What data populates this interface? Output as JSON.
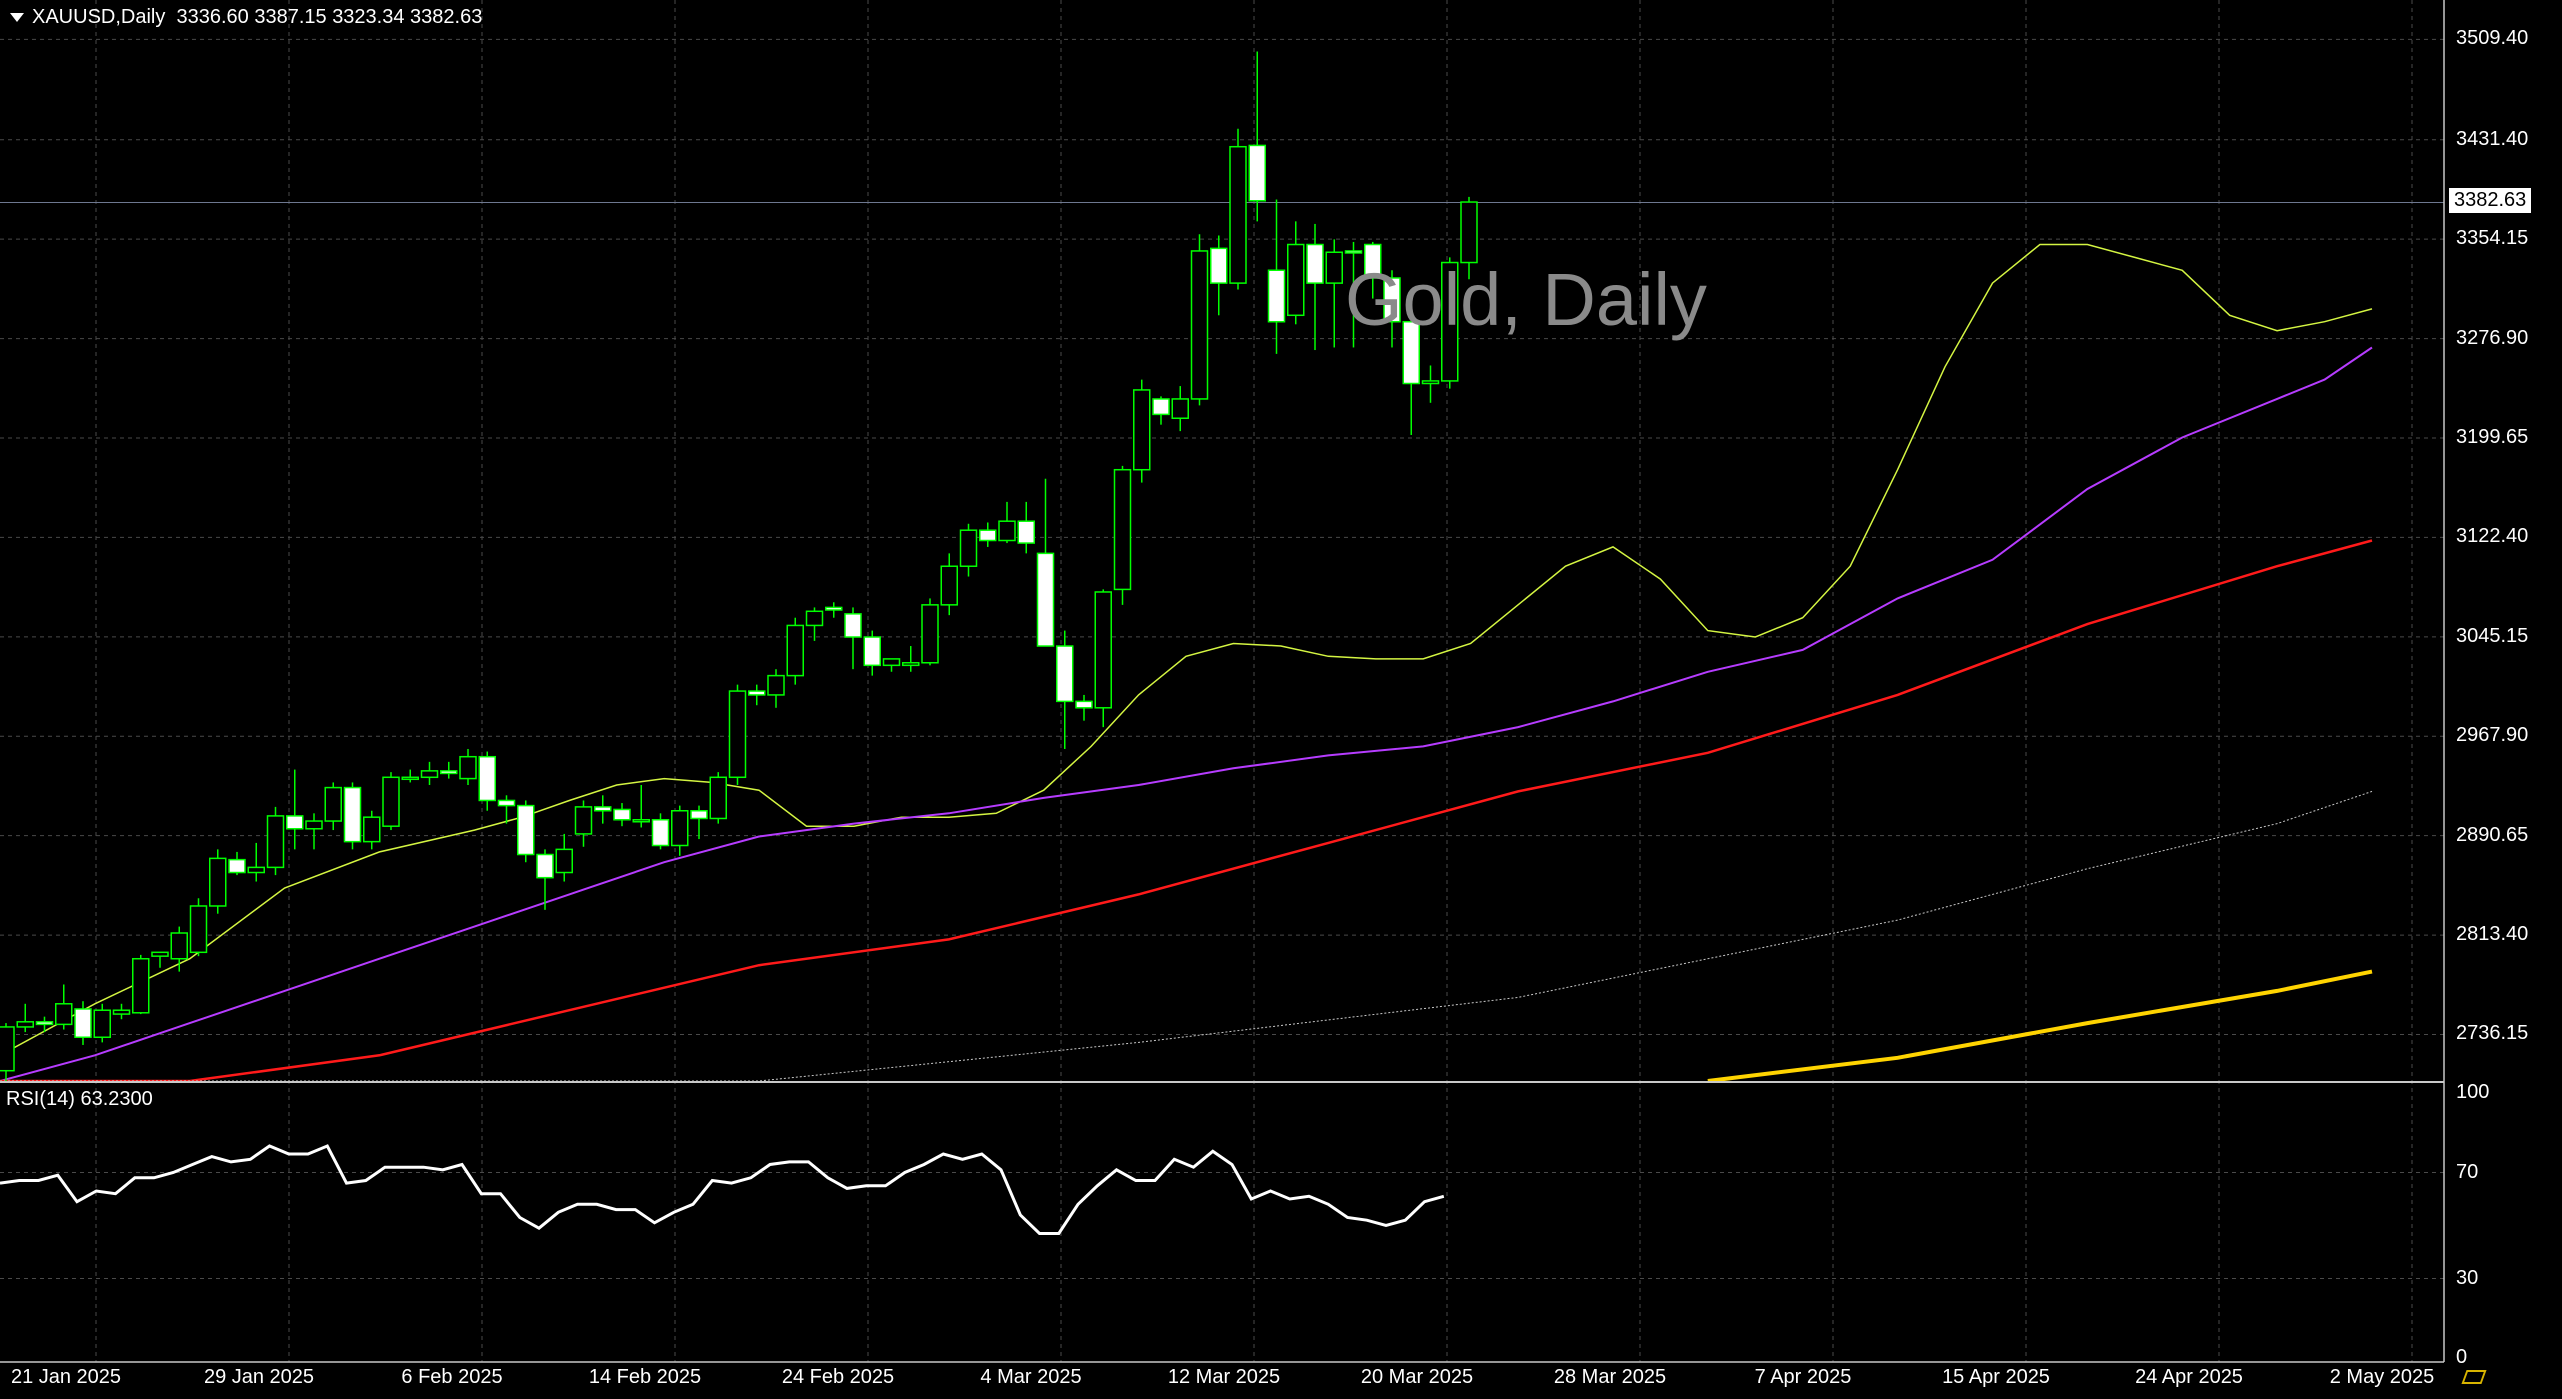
{
  "header": {
    "symbol": "XAUUSD,Daily",
    "ohlc": "3336.60 3387.15 3323.34 3382.63"
  },
  "watermark": "Gold, Daily",
  "last_price_label": "3382.63",
  "rsi_header": "RSI(14) 63.2300",
  "colors": {
    "background": "#000000",
    "candle_up": "#000000",
    "candle_down": "#ffffff",
    "wick": "#00ff00",
    "ma_fast": "#d4f542",
    "ma_mid": "#b63cff",
    "ma_slow": "#ff1a1a",
    "ma_200": "#c8c8c8",
    "ma_yellow": "#ffd400",
    "grid": "#4a4a4a",
    "rsi": "#ffffff"
  },
  "chart_data": {
    "type": "candlestick",
    "symbol": "XAUUSD",
    "timeframe": "Daily",
    "ylim": [
      2700,
      3540
    ],
    "y_ticks": [
      "3509.40",
      "3431.40",
      "3354.15",
      "3276.90",
      "3199.65",
      "3122.40",
      "3045.15",
      "2967.90",
      "2890.65",
      "2813.40",
      "2736.15"
    ],
    "x_ticks": [
      "21 Jan 2025",
      "29 Jan 2025",
      "6 Feb 2025",
      "14 Feb 2025",
      "24 Feb 2025",
      "4 Mar 2025",
      "12 Mar 2025",
      "20 Mar 2025",
      "28 Mar 2025",
      "7 Apr 2025",
      "15 Apr 2025",
      "24 Apr 2025",
      "2 May 2025"
    ],
    "last_price": 3382.63,
    "candles": [
      {
        "o": 2708,
        "h": 2745,
        "l": 2700,
        "c": 2742
      },
      {
        "o": 2742,
        "h": 2760,
        "l": 2738,
        "c": 2746
      },
      {
        "o": 2746,
        "h": 2750,
        "l": 2738,
        "c": 2744
      },
      {
        "o": 2744,
        "h": 2775,
        "l": 2740,
        "c": 2760
      },
      {
        "o": 2756,
        "h": 2762,
        "l": 2728,
        "c": 2734
      },
      {
        "o": 2734,
        "h": 2760,
        "l": 2730,
        "c": 2755
      },
      {
        "o": 2752,
        "h": 2760,
        "l": 2748,
        "c": 2755
      },
      {
        "o": 2753,
        "h": 2798,
        "l": 2752,
        "c": 2795
      },
      {
        "o": 2797,
        "h": 2800,
        "l": 2788,
        "c": 2800
      },
      {
        "o": 2795,
        "h": 2820,
        "l": 2785,
        "c": 2815
      },
      {
        "o": 2800,
        "h": 2842,
        "l": 2797,
        "c": 2836
      },
      {
        "o": 2836,
        "h": 2880,
        "l": 2830,
        "c": 2873
      },
      {
        "o": 2872,
        "h": 2878,
        "l": 2860,
        "c": 2862
      },
      {
        "o": 2862,
        "h": 2885,
        "l": 2855,
        "c": 2866
      },
      {
        "o": 2866,
        "h": 2913,
        "l": 2860,
        "c": 2906
      },
      {
        "o": 2906,
        "h": 2942,
        "l": 2880,
        "c": 2896
      },
      {
        "o": 2896,
        "h": 2908,
        "l": 2880,
        "c": 2902
      },
      {
        "o": 2902,
        "h": 2932,
        "l": 2895,
        "c": 2928
      },
      {
        "o": 2928,
        "h": 2932,
        "l": 2880,
        "c": 2886
      },
      {
        "o": 2886,
        "h": 2910,
        "l": 2880,
        "c": 2905
      },
      {
        "o": 2898,
        "h": 2940,
        "l": 2895,
        "c": 2936
      },
      {
        "o": 2936,
        "h": 2942,
        "l": 2932,
        "c": 2936
      },
      {
        "o": 2936,
        "h": 2948,
        "l": 2930,
        "c": 2941
      },
      {
        "o": 2941,
        "h": 2948,
        "l": 2935,
        "c": 2939
      },
      {
        "o": 2935,
        "h": 2958,
        "l": 2930,
        "c": 2952
      },
      {
        "o": 2952,
        "h": 2956,
        "l": 2910,
        "c": 2918
      },
      {
        "o": 2918,
        "h": 2922,
        "l": 2900,
        "c": 2914
      },
      {
        "o": 2914,
        "h": 2918,
        "l": 2870,
        "c": 2876
      },
      {
        "o": 2876,
        "h": 2880,
        "l": 2833,
        "c": 2858
      },
      {
        "o": 2862,
        "h": 2892,
        "l": 2855,
        "c": 2880
      },
      {
        "o": 2892,
        "h": 2918,
        "l": 2882,
        "c": 2913
      },
      {
        "o": 2913,
        "h": 2922,
        "l": 2900,
        "c": 2910
      },
      {
        "o": 2911,
        "h": 2916,
        "l": 2898,
        "c": 2903
      },
      {
        "o": 2903,
        "h": 2930,
        "l": 2897,
        "c": 2903
      },
      {
        "o": 2903,
        "h": 2908,
        "l": 2880,
        "c": 2883
      },
      {
        "o": 2883,
        "h": 2914,
        "l": 2875,
        "c": 2910
      },
      {
        "o": 2910,
        "h": 2914,
        "l": 2888,
        "c": 2904
      },
      {
        "o": 2904,
        "h": 2940,
        "l": 2900,
        "c": 2936
      },
      {
        "o": 2936,
        "h": 3008,
        "l": 2930,
        "c": 3003
      },
      {
        "o": 3003,
        "h": 3008,
        "l": 2992,
        "c": 3000
      },
      {
        "o": 3000,
        "h": 3020,
        "l": 2990,
        "c": 3015
      },
      {
        "o": 3015,
        "h": 3060,
        "l": 3008,
        "c": 3054
      },
      {
        "o": 3054,
        "h": 3068,
        "l": 3042,
        "c": 3065
      },
      {
        "o": 3068,
        "h": 3072,
        "l": 3060,
        "c": 3066
      },
      {
        "o": 3063,
        "h": 3068,
        "l": 3020,
        "c": 3045
      },
      {
        "o": 3045,
        "h": 3050,
        "l": 3015,
        "c": 3023
      },
      {
        "o": 3023,
        "h": 3028,
        "l": 3018,
        "c": 3028
      },
      {
        "o": 3023,
        "h": 3038,
        "l": 3018,
        "c": 3025
      },
      {
        "o": 3025,
        "h": 3075,
        "l": 3023,
        "c": 3070
      },
      {
        "o": 3070,
        "h": 3110,
        "l": 3062,
        "c": 3100
      },
      {
        "o": 3100,
        "h": 3133,
        "l": 3092,
        "c": 3128
      },
      {
        "o": 3128,
        "h": 3134,
        "l": 3115,
        "c": 3120
      },
      {
        "o": 3120,
        "h": 3150,
        "l": 3118,
        "c": 3135
      },
      {
        "o": 3135,
        "h": 3150,
        "l": 3110,
        "c": 3118
      },
      {
        "o": 3110,
        "h": 3168,
        "l": 3088,
        "c": 3038
      },
      {
        "o": 3038,
        "h": 3050,
        "l": 2958,
        "c": 2995
      },
      {
        "o": 2995,
        "h": 3000,
        "l": 2980,
        "c": 2990
      },
      {
        "o": 2990,
        "h": 3082,
        "l": 2975,
        "c": 3080
      },
      {
        "o": 3082,
        "h": 3178,
        "l": 3070,
        "c": 3175
      },
      {
        "o": 3175,
        "h": 3245,
        "l": 3165,
        "c": 3237
      },
      {
        "o": 3230,
        "h": 3232,
        "l": 3210,
        "c": 3218
      },
      {
        "o": 3215,
        "h": 3240,
        "l": 3205,
        "c": 3230
      },
      {
        "o": 3230,
        "h": 3358,
        "l": 3225,
        "c": 3345
      },
      {
        "o": 3347,
        "h": 3357,
        "l": 3295,
        "c": 3320
      },
      {
        "o": 3320,
        "h": 3440,
        "l": 3315,
        "c": 3426
      },
      {
        "o": 3427,
        "h": 3500,
        "l": 3368,
        "c": 3384
      },
      {
        "o": 3330,
        "h": 3385,
        "l": 3265,
        "c": 3290
      },
      {
        "o": 3295,
        "h": 3368,
        "l": 3288,
        "c": 3350
      },
      {
        "o": 3350,
        "h": 3366,
        "l": 3268,
        "c": 3320
      },
      {
        "o": 3320,
        "h": 3354,
        "l": 3270,
        "c": 3344
      },
      {
        "o": 3345,
        "h": 3352,
        "l": 3270,
        "c": 3344
      },
      {
        "o": 3350,
        "h": 3352,
        "l": 3308,
        "c": 3324
      },
      {
        "o": 3324,
        "h": 3330,
        "l": 3270,
        "c": 3290
      },
      {
        "o": 3290,
        "h": 3294,
        "l": 3202,
        "c": 3242
      },
      {
        "o": 3242,
        "h": 3256,
        "l": 3227,
        "c": 3244
      },
      {
        "o": 3244,
        "h": 3340,
        "l": 3238,
        "c": 3336
      },
      {
        "o": 3336,
        "h": 3387,
        "l": 3323,
        "c": 3383
      }
    ],
    "series": [
      {
        "points": [
          [
            0,
            2720
          ],
          [
            10,
            2760
          ],
          [
            20,
            2795
          ],
          [
            30,
            2850
          ],
          [
            40,
            2878
          ],
          [
            50,
            2895
          ],
          [
            55,
            2905
          ],
          [
            60,
            2918
          ],
          [
            65,
            2930
          ],
          [
            70,
            2935
          ],
          [
            75,
            2932
          ],
          [
            80,
            2926
          ],
          [
            85,
            2898
          ],
          [
            90,
            2898
          ],
          [
            95,
            2905
          ],
          [
            100,
            2905
          ],
          [
            105,
            2908
          ],
          [
            110,
            2926
          ],
          [
            115,
            2960
          ],
          [
            120,
            3000
          ],
          [
            125,
            3030
          ],
          [
            130,
            3040
          ],
          [
            135,
            3038
          ],
          [
            140,
            3030
          ],
          [
            145,
            3028
          ],
          [
            150,
            3028
          ],
          [
            155,
            3040
          ],
          [
            160,
            3070
          ],
          [
            165,
            3100
          ],
          [
            170,
            3115
          ],
          [
            175,
            3090
          ],
          [
            180,
            3050
          ],
          [
            185,
            3045
          ],
          [
            190,
            3060
          ],
          [
            195,
            3100
          ],
          [
            200,
            3175
          ],
          [
            205,
            3255
          ],
          [
            210,
            3320
          ],
          [
            215,
            3350
          ],
          [
            220,
            3350
          ],
          [
            225,
            3340
          ],
          [
            230,
            3330
          ],
          [
            235,
            3295
          ],
          [
            240,
            3283
          ],
          [
            245,
            3290
          ],
          [
            250,
            3300
          ]
        ]
      },
      {
        "points": [
          [
            0,
            2700
          ],
          [
            10,
            2720
          ],
          [
            20,
            2745
          ],
          [
            30,
            2770
          ],
          [
            40,
            2795
          ],
          [
            50,
            2820
          ],
          [
            60,
            2845
          ],
          [
            70,
            2870
          ],
          [
            80,
            2890
          ],
          [
            90,
            2900
          ],
          [
            100,
            2908
          ],
          [
            110,
            2920
          ],
          [
            120,
            2930
          ],
          [
            130,
            2943
          ],
          [
            140,
            2953
          ],
          [
            150,
            2960
          ],
          [
            160,
            2975
          ],
          [
            170,
            2995
          ],
          [
            180,
            3018
          ],
          [
            190,
            3035
          ],
          [
            200,
            3075
          ],
          [
            210,
            3105
          ],
          [
            220,
            3160
          ],
          [
            230,
            3200
          ],
          [
            240,
            3230
          ],
          [
            245,
            3245
          ],
          [
            250,
            3270
          ]
        ]
      },
      {
        "points": [
          [
            0,
            2650
          ],
          [
            20,
            2690
          ],
          [
            40,
            2720
          ],
          [
            60,
            2755
          ],
          [
            80,
            2790
          ],
          [
            100,
            2810
          ],
          [
            120,
            2845
          ],
          [
            140,
            2885
          ],
          [
            160,
            2925
          ],
          [
            180,
            2955
          ],
          [
            200,
            3000
          ],
          [
            220,
            3055
          ],
          [
            240,
            3100
          ],
          [
            250,
            3120
          ]
        ]
      },
      {
        "points": [
          [
            0,
            2600
          ],
          [
            40,
            2660
          ],
          [
            80,
            2700
          ],
          [
            120,
            2730
          ],
          [
            160,
            2765
          ],
          [
            200,
            2825
          ],
          [
            220,
            2865
          ],
          [
            240,
            2900
          ],
          [
            250,
            2925
          ]
        ]
      },
      {
        "points": [
          [
            180,
            2600
          ],
          [
            200,
            2718
          ],
          [
            220,
            2745
          ],
          [
            240,
            2770
          ],
          [
            250,
            2785
          ]
        ]
      }
    ],
    "rsi": {
      "label": "RSI(14)",
      "value": 63.23,
      "levels": [
        100,
        70,
        30,
        0
      ],
      "values": [
        66,
        67,
        67,
        69,
        59,
        63,
        62,
        68,
        68,
        70,
        73,
        76,
        74,
        75,
        80,
        77,
        77,
        80,
        66,
        67,
        72,
        72,
        72,
        71,
        73,
        62,
        62,
        53,
        49,
        55,
        58,
        58,
        56,
        56,
        51,
        55,
        58,
        67,
        66,
        68,
        73,
        74,
        74,
        68,
        64,
        65,
        65,
        70,
        73,
        77,
        75,
        77,
        71,
        54,
        47,
        47,
        58,
        65,
        71,
        67,
        67,
        75,
        72,
        78,
        73,
        60,
        63,
        60,
        61,
        58,
        53,
        52,
        50,
        52,
        59,
        61
      ]
    }
  }
}
